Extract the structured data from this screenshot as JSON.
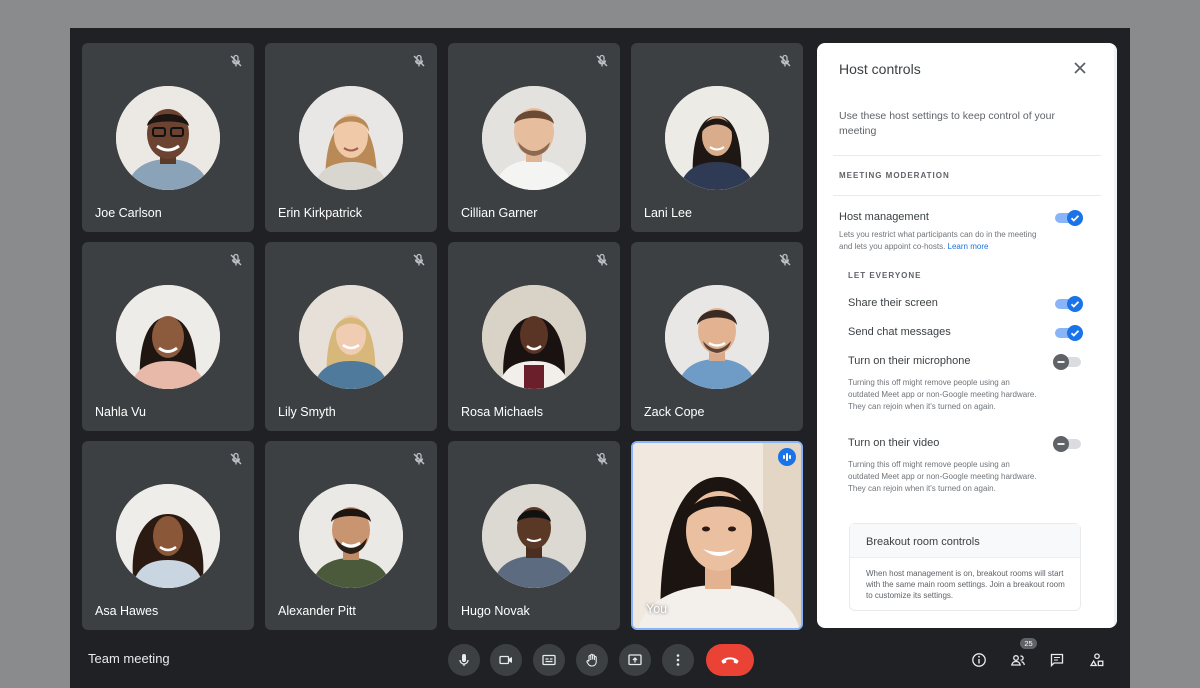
{
  "meeting": {
    "title": "Team meeting"
  },
  "colors": {
    "accent": "#1a73e8",
    "end_call": "#ea4335",
    "tile_bg": "#3c4043",
    "app_bg": "#202124"
  },
  "participants": [
    {
      "name": "Joe Carlson",
      "muted": true
    },
    {
      "name": "Erin Kirkpatrick",
      "muted": true
    },
    {
      "name": "Cillian Garner",
      "muted": true
    },
    {
      "name": "Lani Lee",
      "muted": true
    },
    {
      "name": "Nahla Vu",
      "muted": true
    },
    {
      "name": "Lily Smyth",
      "muted": true
    },
    {
      "name": "Rosa Michaels",
      "muted": true
    },
    {
      "name": "Zack Cope",
      "muted": true
    },
    {
      "name": "Asa Hawes",
      "muted": true
    },
    {
      "name": "Alexander Pitt",
      "muted": true
    },
    {
      "name": "Hugo Novak",
      "muted": true
    },
    {
      "name": "You",
      "speaking": true
    }
  ],
  "panel": {
    "title": "Host controls",
    "description": "Use these host settings to keep control of your meeting",
    "moderation_label": "MEETING MODERATION",
    "host_management": {
      "label": "Host management",
      "description": "Lets you restrict what participants can do in the meeting and lets you appoint co-hosts.",
      "learn_more": "Learn more",
      "enabled": true
    },
    "let_everyone_label": "LET EVERYONE",
    "settings": [
      {
        "label": "Share their screen",
        "enabled": true
      },
      {
        "label": "Send chat messages",
        "enabled": true
      },
      {
        "label": "Turn on their microphone",
        "enabled": false,
        "description": "Turning this off might remove people using an outdated Meet app or non-Google meeting hardware. They can rejoin when it's turned on again."
      },
      {
        "label": "Turn on their video",
        "enabled": false,
        "description": "Turning this off might remove people using an outdated Meet app or non-Google meeting hardware. They can rejoin when it's turned on again."
      }
    ],
    "breakout": {
      "title": "Breakout room controls",
      "text": "When host management is on, breakout rooms will start with the same main room settings. Join a breakout room to customize its settings."
    }
  },
  "toolbar": {
    "controls": [
      "mic-icon",
      "camera-icon",
      "captions-icon",
      "raise-hand-icon",
      "present-icon",
      "more-options-icon"
    ],
    "end_call": "end-call-icon",
    "right": [
      "info-icon",
      "people-icon",
      "chat-icon",
      "activities-icon"
    ],
    "participant_count": "25"
  }
}
